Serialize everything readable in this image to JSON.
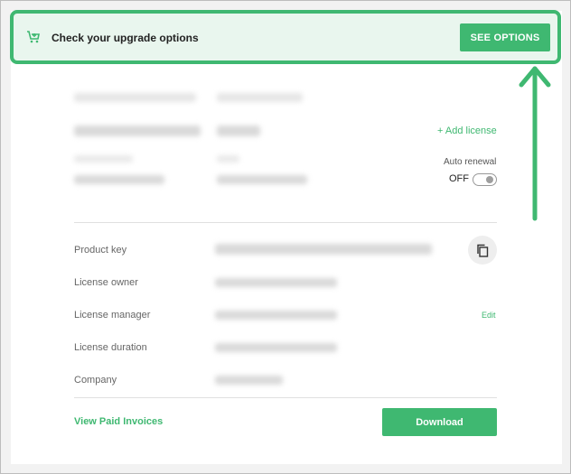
{
  "banner": {
    "icon": "cart-upgrade-icon",
    "text": "Check your upgrade options",
    "button_label": "SEE OPTIONS"
  },
  "license": {
    "add_license_label": "+ Add license",
    "auto_renewal_label": "Auto renewal",
    "auto_renewal_state": "OFF"
  },
  "details": {
    "rows": [
      {
        "label": "Product key"
      },
      {
        "label": "License owner"
      },
      {
        "label": "License manager"
      },
      {
        "label": "License duration"
      },
      {
        "label": "Company"
      }
    ],
    "edit_label": "Edit"
  },
  "footer": {
    "view_invoices_label": "View Paid Invoices",
    "download_label": "Download"
  },
  "colors": {
    "accent": "#3fb871",
    "banner_bg": "#e9f6ee"
  }
}
